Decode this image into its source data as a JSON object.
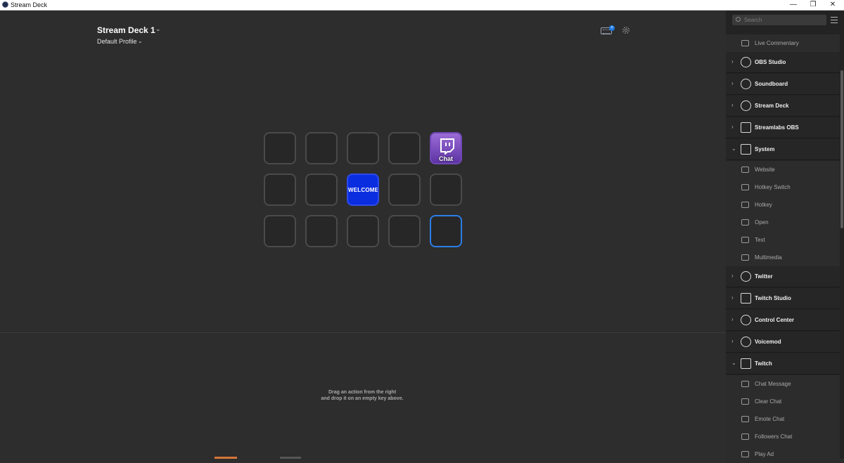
{
  "window": {
    "title": "Stream Deck",
    "minimize": "—",
    "maximize": "❐",
    "close": "✕"
  },
  "header": {
    "device_name": "Stream Deck 1",
    "profile": "Default Profile"
  },
  "keys": [
    {
      "label": ""
    },
    {
      "label": ""
    },
    {
      "label": ""
    },
    {
      "label": ""
    },
    {
      "label": "Chat",
      "type": "twitch-chat"
    },
    {
      "label": ""
    },
    {
      "label": ""
    },
    {
      "label": "WELCOME",
      "type": "welcome"
    },
    {
      "label": ""
    },
    {
      "label": ""
    },
    {
      "label": ""
    },
    {
      "label": ""
    },
    {
      "label": ""
    },
    {
      "label": ""
    },
    {
      "label": "",
      "selected": true
    }
  ],
  "hint": {
    "line1": "Drag an action from the right",
    "line2": "and drop it on an empty key above."
  },
  "sidebar": {
    "search_placeholder": "Search",
    "items": [
      {
        "label": "Live Commentary",
        "kind": "item",
        "icon": "microphone-icon"
      },
      {
        "label": "OBS Studio",
        "kind": "category",
        "icon": "obs-icon"
      },
      {
        "label": "Soundboard",
        "kind": "category",
        "icon": "speaker-icon"
      },
      {
        "label": "Stream Deck",
        "kind": "category",
        "icon": "stream-deck-icon"
      },
      {
        "label": "Streamlabs OBS",
        "kind": "category",
        "icon": "streamlabs-icon"
      },
      {
        "label": "System",
        "kind": "category",
        "icon": "system-icon",
        "expanded": true
      },
      {
        "label": "Website",
        "kind": "item",
        "icon": "globe-icon"
      },
      {
        "label": "Hotkey Switch",
        "kind": "item",
        "icon": "toggle-icon"
      },
      {
        "label": "Hotkey",
        "kind": "item",
        "icon": "keyboard-icon"
      },
      {
        "label": "Open",
        "kind": "item",
        "icon": "rocket-icon"
      },
      {
        "label": "Text",
        "kind": "item",
        "icon": "text-icon"
      },
      {
        "label": "Multimedia",
        "kind": "item",
        "icon": "play-pause-icon"
      },
      {
        "label": "Twitter",
        "kind": "category",
        "icon": "twitter-icon"
      },
      {
        "label": "Twitch Studio",
        "kind": "category",
        "icon": "twitch-studio-icon"
      },
      {
        "label": "Control Center",
        "kind": "category",
        "icon": "control-center-icon"
      },
      {
        "label": "Voicemod",
        "kind": "category",
        "icon": "voicemod-icon"
      },
      {
        "label": "Twitch",
        "kind": "category",
        "icon": "twitch-icon",
        "expanded": true
      },
      {
        "label": "Chat Message",
        "kind": "item",
        "icon": "chat-icon"
      },
      {
        "label": "Clear Chat",
        "kind": "item",
        "icon": "clear-chat-icon"
      },
      {
        "label": "Emote Chat",
        "kind": "item",
        "icon": "emote-icon"
      },
      {
        "label": "Followers Chat",
        "kind": "item",
        "icon": "followers-icon"
      },
      {
        "label": "Play Ad",
        "kind": "item",
        "icon": "ad-icon"
      }
    ]
  },
  "colors": {
    "accent": "#2b7ee6",
    "twitch": "#6f47b5",
    "welcome": "#0a2de0"
  }
}
